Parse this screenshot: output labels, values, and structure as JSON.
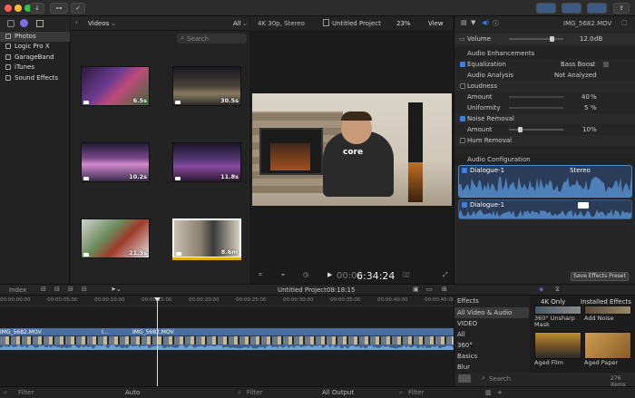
{
  "toolbar": {
    "import_icon": "download-icon",
    "keywords_icon": "key-icon",
    "check_icon": "checkmark-icon"
  },
  "sidebar": {
    "items": [
      {
        "label": "Photos",
        "selected": true
      },
      {
        "label": "Logic Pro X",
        "selected": false
      },
      {
        "label": "GarageBand",
        "selected": false
      },
      {
        "label": "iTunes",
        "selected": false
      },
      {
        "label": "Sound Effects",
        "selected": false
      }
    ]
  },
  "browser": {
    "title": "Videos",
    "filter": "All",
    "search_placeholder": "Search",
    "clips": [
      {
        "duration": "6.5s"
      },
      {
        "duration": "30.5s"
      },
      {
        "duration": "10.2s"
      },
      {
        "duration": "11.8s"
      },
      {
        "duration": "21.3s"
      },
      {
        "duration": "8.6m"
      }
    ]
  },
  "viewer": {
    "format": "4K 30p, Stereo",
    "project": "Untitled Project",
    "zoom": "23%",
    "view_label": "View",
    "timecode": "6:34:24",
    "timecode_prefix": "00:00"
  },
  "inspector": {
    "file_name": "IMG_5682.MOV",
    "volume_label": "Volume",
    "volume_value": "12.0",
    "volume_unit": "dB",
    "audio_enhancements": "Audio Enhancements",
    "equalization_label": "Equalization",
    "equalization_value": "Bass Boost",
    "audio_analysis_label": "Audio Analysis",
    "audio_analysis_value": "Not Analyzed",
    "loudness_label": "Loudness",
    "amount_label": "Amount",
    "loudness_amount": "40",
    "uniformity_label": "Uniformity",
    "uniformity_value": "5",
    "noise_removal_label": "Noise Removal",
    "noise_amount_label": "Amount",
    "noise_amount": "10",
    "percent": "%",
    "hum_removal_label": "Hum Removal",
    "audio_config_label": "Audio Configuration",
    "channel1": "Dialogue-1",
    "channel1_mode": "Stereo",
    "channel2": "Dialogue-1",
    "save_preset": "Save Effects Preset"
  },
  "timeline": {
    "index_label": "Index",
    "project": "Untitled Project",
    "duration": "08:18:15",
    "ruler": [
      "00:00:00:00",
      "00:00:05:00",
      "00:00:10:00",
      "00:00:15:00",
      "00:00:20:00",
      "00:00:25:00",
      "00:00:30:00",
      "00:00:35:00",
      "00:00:40:00",
      "00:00:45:00"
    ],
    "clip1": "IMG_5682.MOV",
    "clip2": "I...",
    "clip3": "IMG_5682.MOV"
  },
  "effects": {
    "title": "Effects",
    "categories": [
      "All Video & Audio",
      "VIDEO",
      "All",
      "360°",
      "Basics",
      "Blur"
    ],
    "header1": "4K Only",
    "header2": "Installed Effects",
    "items": [
      {
        "label": "360° Unsharp Mask"
      },
      {
        "label": "Add Noise"
      },
      {
        "label": "Aged Film"
      },
      {
        "label": "Aged Paper"
      }
    ],
    "search_placeholder": "Search",
    "count": "276 items"
  },
  "bottombar": {
    "filter1": "Filter",
    "auto_label": "Auto",
    "filter2": "Filter",
    "output_label": "All Output",
    "filter3": "Filter"
  },
  "colors": {
    "accent": "#3d7ee3",
    "waveform": "#4d7fb8",
    "clip": "#4a6e9e"
  }
}
